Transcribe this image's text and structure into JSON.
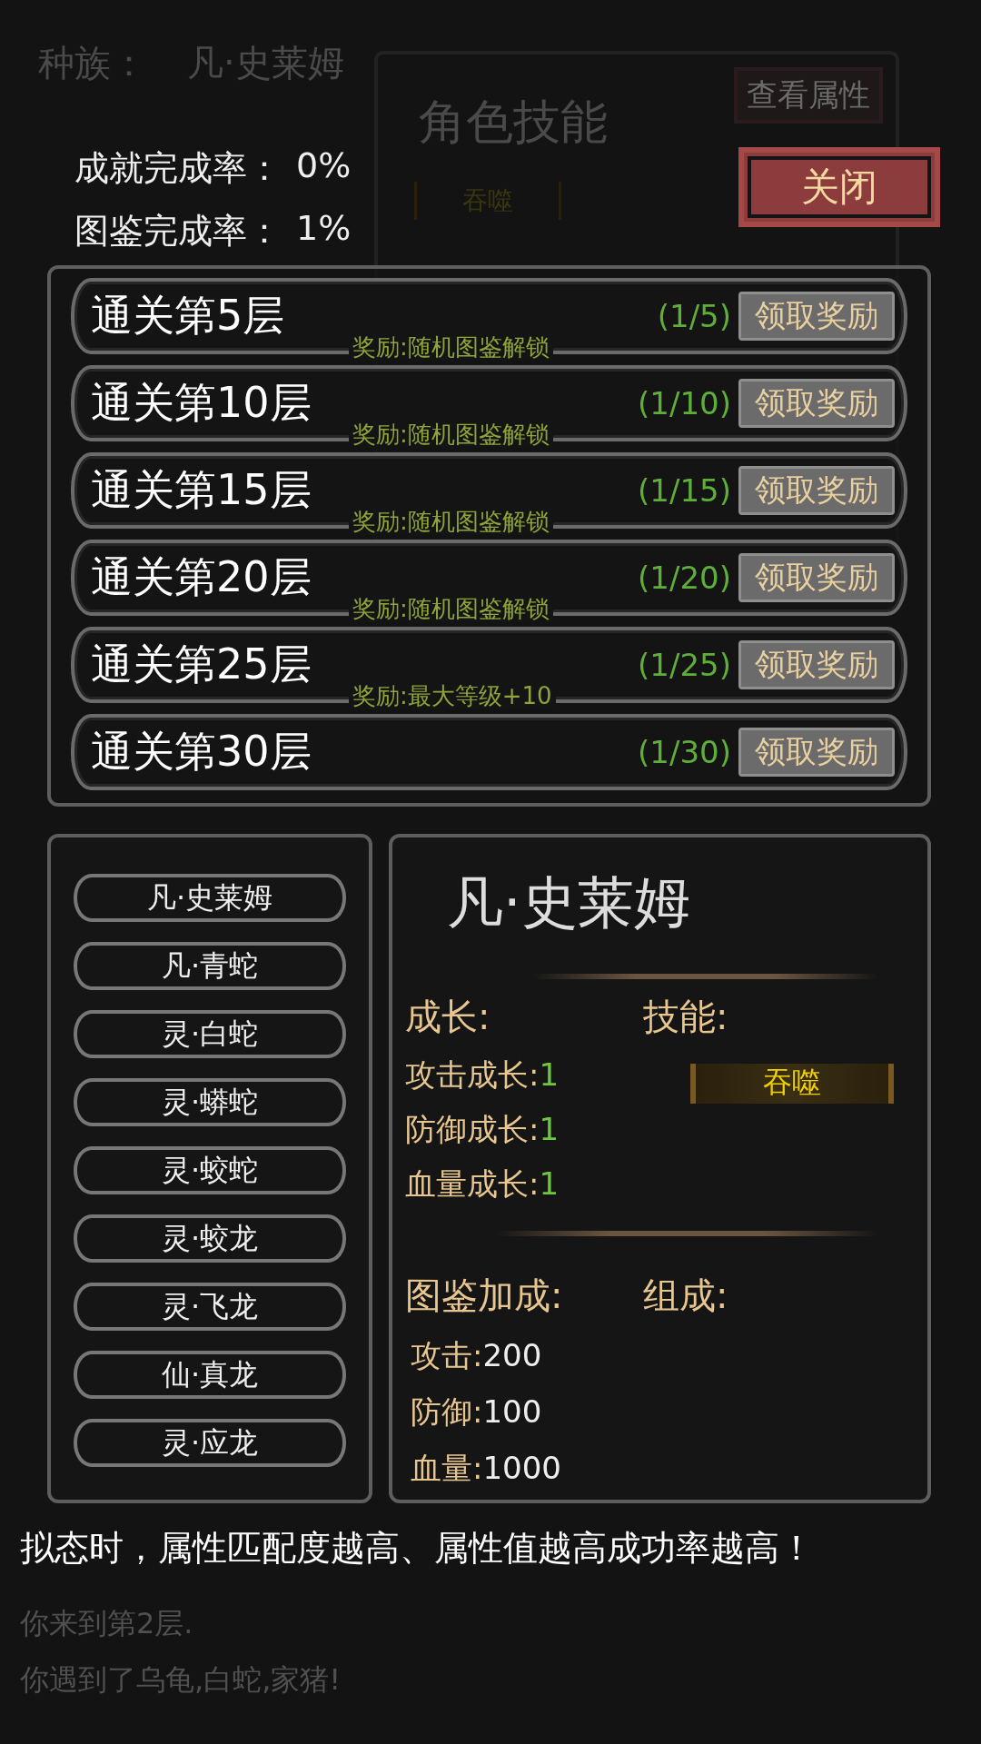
{
  "background": {
    "race_label": "种族：",
    "race": "凡·史莱姆",
    "skills_title": "角色技能",
    "view_button": "查看属性",
    "skill_chip": "吞噬",
    "log": [
      "你来到第2层.",
      "你遇到了乌龟,白蛇,家猪!"
    ]
  },
  "summary": [
    {
      "label": "成就完成率：",
      "value": "0%"
    },
    {
      "label": "图鉴完成率：",
      "value": "1%"
    }
  ],
  "close_button": "关闭",
  "achievements": [
    {
      "title": "通关第5层",
      "reward": "奖励:随机图鉴解锁",
      "progress": "(1/5)",
      "button": "领取奖励"
    },
    {
      "title": "通关第10层",
      "reward": "奖励:随机图鉴解锁",
      "progress": "(1/10)",
      "button": "领取奖励"
    },
    {
      "title": "通关第15层",
      "reward": "奖励:随机图鉴解锁",
      "progress": "(1/15)",
      "button": "领取奖励"
    },
    {
      "title": "通关第20层",
      "reward": "奖励:随机图鉴解锁",
      "progress": "(1/20)",
      "button": "领取奖励"
    },
    {
      "title": "通关第25层",
      "reward": "奖励:最大等级+10",
      "progress": "(1/25)",
      "button": "领取奖励"
    },
    {
      "title": "通关第30层",
      "progress": "(1/30)",
      "button": "领取奖励"
    }
  ],
  "creatures": [
    "凡·史莱姆",
    "凡·青蛇",
    "灵·白蛇",
    "灵·蟒蛇",
    "灵·蛟蛇",
    "灵·蛟龙",
    "灵·飞龙",
    "仙·真龙",
    "灵·应龙"
  ],
  "detail": {
    "name": "凡·史莱姆",
    "growth_title": "成长:",
    "skills_title": "技能:",
    "growth": [
      {
        "label": "攻击成长:",
        "value": "1"
      },
      {
        "label": "防御成长:",
        "value": "1"
      },
      {
        "label": "血量成长:",
        "value": "1"
      }
    ],
    "skills": [
      "吞噬"
    ],
    "bonus_title": "图鉴加成:",
    "composition_title": "组成:",
    "bonus": [
      {
        "label": "攻击:",
        "value": "200"
      },
      {
        "label": "防御:",
        "value": "100"
      },
      {
        "label": "血量:",
        "value": "1000"
      }
    ]
  },
  "tip": "拟态时，属性匹配度越高、属性值越高成功率越高！"
}
